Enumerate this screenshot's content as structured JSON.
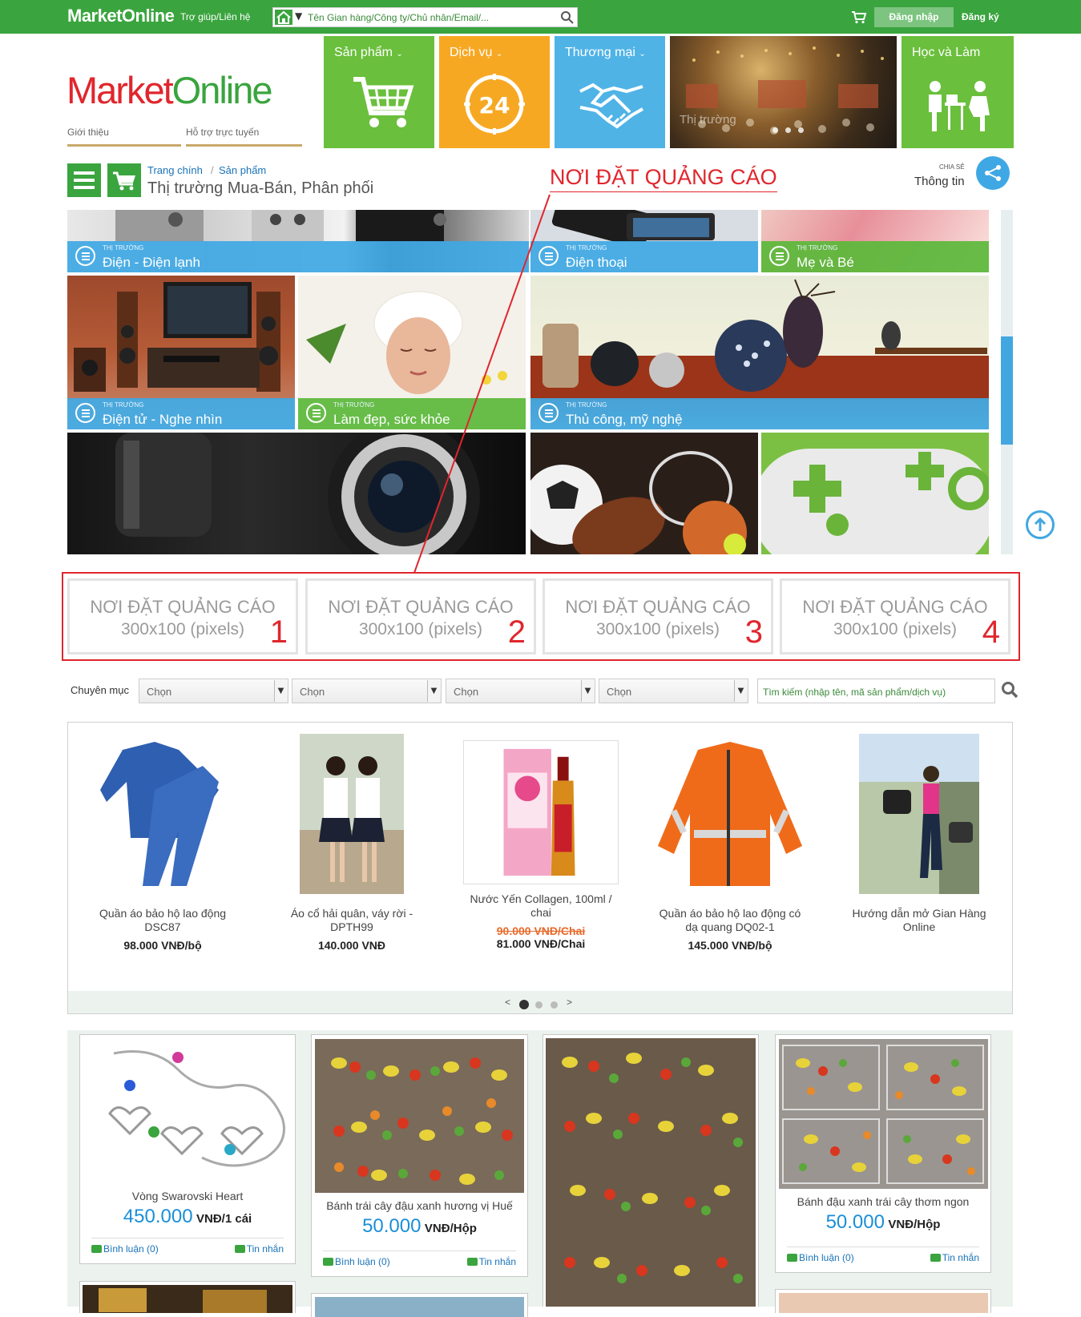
{
  "topbar": {
    "brand": "MarketOnline",
    "help": "Trợ giúp/Liên hệ",
    "search_placeholder": "Tên Gian hàng/Công ty/Chủ nhân/Email/...",
    "login": "Đăng nhập",
    "register": "Đăng ký"
  },
  "logo": {
    "market": "Market",
    "online": "Online"
  },
  "sublinks": [
    "Giới thiệu",
    "Hỗ trợ trực tuyến"
  ],
  "tiles": [
    {
      "label": "Sản phẩm",
      "color": "#6abf3c"
    },
    {
      "label": "Dịch vụ",
      "color": "#f7a823"
    },
    {
      "label": "Thương mại",
      "color": "#4fb3e6"
    },
    {
      "label": "Thị trường",
      "color": "#7a5c2e"
    },
    {
      "label": "Học và Làm",
      "color": "#6abf3c"
    }
  ],
  "clock_number": "24",
  "section": {
    "breadcrumb": [
      "Trang chính",
      "Sản phẩm"
    ],
    "title": "Thị trường Mua-Bán, Phân phối",
    "ad_note": "NƠI ĐẶT QUẢNG CÁO",
    "share_small": "CHIA SẺ",
    "share_label": "Thông tin"
  },
  "market_prefix": "THỊ TRƯỜNG",
  "markets": [
    {
      "name": "Điện - Điện lạnh",
      "bar": "blue"
    },
    {
      "name": "Điện thoại",
      "bar": "blue"
    },
    {
      "name": "Mẹ và Bé",
      "bar": "green"
    },
    {
      "name": "Điện tử - Nghe nhìn",
      "bar": "blue"
    },
    {
      "name": "Làm đẹp, sức khỏe",
      "bar": "green"
    },
    {
      "name": "Thủ công, mỹ nghệ",
      "bar": "blue"
    }
  ],
  "ads": [
    {
      "line1": "NƠI ĐẶT QUẢNG CÁO",
      "line2": "300x100 (pixels)",
      "num": "1"
    },
    {
      "line1": "NƠI ĐẶT QUẢNG CÁO",
      "line2": "300x100 (pixels)",
      "num": "2"
    },
    {
      "line1": "NƠI ĐẶT QUẢNG CÁO",
      "line2": "300x100 (pixels)",
      "num": "3"
    },
    {
      "line1": "NƠI ĐẶT QUẢNG CÁO",
      "line2": "300x100 (pixels)",
      "num": "4"
    }
  ],
  "filters": {
    "label": "Chuyên mục",
    "selects": [
      "Chọn",
      "Chọn",
      "Chọn",
      "Chọn"
    ],
    "search_placeholder": "Tìm kiếm (nhập tên, mã sản phẩm/dịch vụ)"
  },
  "featured": [
    {
      "name": "Quần áo bảo hộ lao động DSC87",
      "price": "98.000 VNĐ/bộ"
    },
    {
      "name": "Áo cổ hải quân, váy rời - DPTH99",
      "price": "140.000 VNĐ"
    },
    {
      "name": "Nước Yến Collagen, 100ml / chai",
      "old_price": "90.000 VNĐ/Chai",
      "price": "81.000 VNĐ/Chai"
    },
    {
      "name": "Quần áo bảo hộ lao động có dạ quang DQ02-1",
      "price": "145.000 VNĐ/bộ"
    },
    {
      "name": "Hướng dẫn mở Gian Hàng Online",
      "price": ""
    }
  ],
  "carousel_nav": {
    "prev": "<",
    "next": ">"
  },
  "products": [
    {
      "name": "Vòng Swarovski Heart",
      "price": "450.000",
      "unit": "VNĐ/1 cái"
    },
    {
      "name": "Bánh trái cây đậu xanh hương vị Huế",
      "price": "50.000",
      "unit": "VNĐ/Hộp"
    },
    {
      "name": "",
      "price": "",
      "unit": ""
    },
    {
      "name": "Bánh đậu xanh trái cây thơm ngon",
      "price": "50.000",
      "unit": "VNĐ/Hộp"
    }
  ],
  "card_links": {
    "comment": "Bình luận (0)",
    "message": "Tin nhắn"
  }
}
